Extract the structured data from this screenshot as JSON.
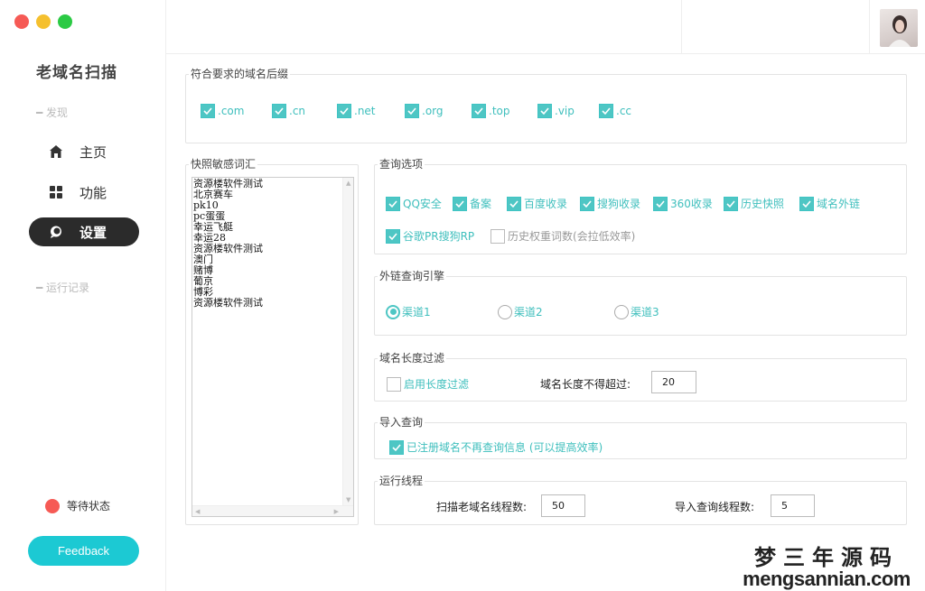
{
  "app": {
    "title": "老域名扫描"
  },
  "sidebar": {
    "section_discover": "━ 发现",
    "items": [
      {
        "label": "主页",
        "icon": "home-icon"
      },
      {
        "label": "功能",
        "icon": "grid-icon"
      },
      {
        "label": "设置",
        "icon": "chat-icon",
        "active": true
      }
    ],
    "section_log": "━ 运行记录",
    "status": "等待状态",
    "feedback": "Feedback"
  },
  "suffix_group": {
    "title": "符合要求的域名后缀",
    "items": [
      ".com",
      ".cn",
      ".net",
      ".org",
      ".top",
      ".vip",
      ".cc"
    ]
  },
  "keywords_group": {
    "title": "快照敏感词汇",
    "text": "资源楼软件测试\n北京赛车\npk10\npc蛋蛋\n幸运飞艇\n幸运28\n资源楼软件测试\n澳门\n赌博\n葡京\n博彩\n资源楼软件测试"
  },
  "query_options": {
    "title": "查询选项",
    "items": [
      "QQ安全",
      "备案",
      "百度收录",
      "搜狗收录",
      "360收录",
      "历史快照",
      "域名外链",
      "谷歌PR搜狗RP"
    ],
    "unchecked_item": "历史权重词数(会拉低效率)"
  },
  "link_engine": {
    "title": "外链查询引擎",
    "options": [
      "渠道1",
      "渠道2",
      "渠道3"
    ],
    "selected": "渠道1"
  },
  "length_filter": {
    "title": "域名长度过滤",
    "checkbox": "启用长度过滤",
    "max_label": "域名长度不得超过:",
    "max_value": "20"
  },
  "import_query": {
    "title": "导入查询",
    "checkbox": "已注册域名不再查询信息 (可以提高效率)"
  },
  "threads": {
    "title": "运行线程",
    "scan_label": "扫描老域名线程数:",
    "scan_value": "50",
    "import_label": "导入查询线程数:",
    "import_value": "5"
  },
  "watermark": {
    "line1": "梦三年源码",
    "line2": "mengsannian.com"
  },
  "colors": {
    "accent": "#4ec6c4",
    "feedback": "#1cc9d3",
    "status_dot": "#f65a55",
    "active_nav": "#2b2b2b"
  }
}
